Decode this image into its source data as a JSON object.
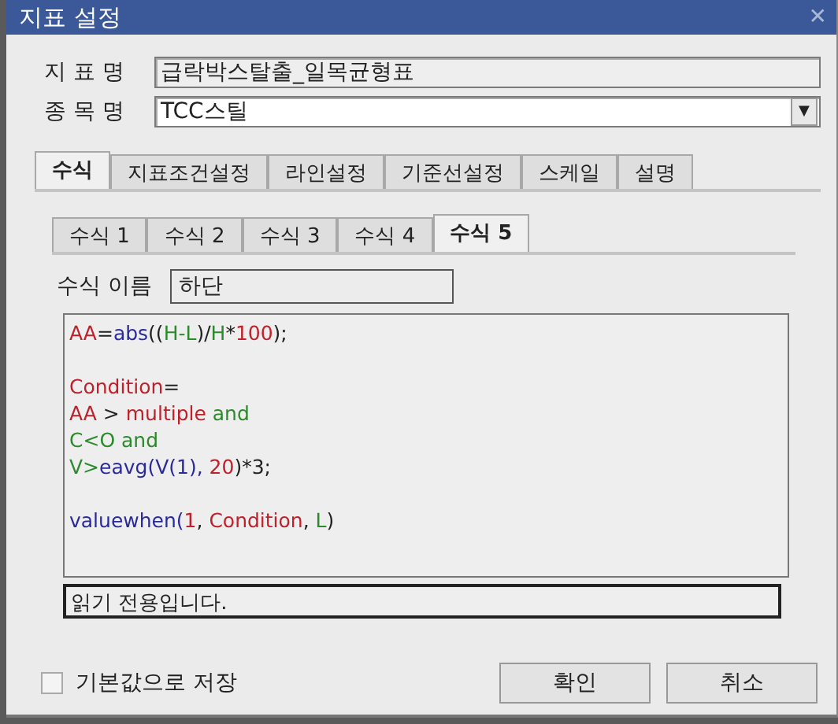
{
  "window": {
    "title": "지표 설정",
    "close": "✕"
  },
  "fields": [
    {
      "kind": "text",
      "label": "지 표 명",
      "value": "급락박스탈출_일목균형표"
    },
    {
      "kind": "dropdown",
      "label": "종 목 명",
      "value": "TCC스틸",
      "arrow": "▼"
    }
  ],
  "tabs": [
    {
      "label": "수식",
      "selected": true
    },
    {
      "label": "지표조건설정",
      "selected": false
    },
    {
      "label": "라인설정",
      "selected": false
    },
    {
      "label": "기준선설정",
      "selected": false
    },
    {
      "label": "스케일",
      "selected": false
    },
    {
      "label": "설명",
      "selected": false
    }
  ],
  "subtabs": [
    {
      "label": "수식 1",
      "selected": false
    },
    {
      "label": "수식 2",
      "selected": false
    },
    {
      "label": "수식 3",
      "selected": false
    },
    {
      "label": "수식 4",
      "selected": false
    },
    {
      "label": "수식 5",
      "selected": true
    }
  ],
  "formula_name": {
    "label": "수식 이름",
    "value": "하단"
  },
  "code_blocks": [
    [
      [
        {
          "text": "AA",
          "kind": "variable"
        },
        {
          "text": "=",
          "kind": "plain"
        },
        {
          "text": "abs",
          "kind": "function"
        },
        {
          "text": "((",
          "kind": "plain"
        },
        {
          "text": "H-L",
          "kind": "series"
        },
        {
          "text": ")/",
          "kind": "plain"
        },
        {
          "text": "H",
          "kind": "series"
        },
        {
          "text": "*",
          "kind": "plain"
        },
        {
          "text": "100",
          "kind": "variable"
        },
        {
          "text": ");",
          "kind": "plain"
        }
      ]
    ],
    [
      [
        {
          "text": "Condition",
          "kind": "variable"
        },
        {
          "text": "=",
          "kind": "plain"
        }
      ],
      [
        {
          "text": "AA",
          "kind": "variable"
        },
        {
          "text": " > ",
          "kind": "plain"
        },
        {
          "text": "multiple",
          "kind": "variable"
        },
        {
          "text": " and",
          "kind": "series"
        }
      ],
      [
        {
          "text": "C<O and",
          "kind": "series"
        }
      ],
      [
        {
          "text": "V>",
          "kind": "series"
        },
        {
          "text": "eavg(V(1), ",
          "kind": "function"
        },
        {
          "text": "20",
          "kind": "variable"
        },
        {
          "text": ")*3;",
          "kind": "plain"
        }
      ]
    ],
    [
      [
        {
          "text": "valuewhen(",
          "kind": "function"
        },
        {
          "text": "1",
          "kind": "variable"
        },
        {
          "text": ", ",
          "kind": "plain"
        },
        {
          "text": "Condition",
          "kind": "variable"
        },
        {
          "text": ", ",
          "kind": "plain"
        },
        {
          "text": "L",
          "kind": "series"
        },
        {
          "text": ")",
          "kind": "plain"
        }
      ]
    ]
  ],
  "status": "읽기 전용입니다.",
  "save_default": {
    "label": "기본값으로 저장",
    "checked": false
  },
  "buttons": [
    "확인",
    "취소"
  ]
}
